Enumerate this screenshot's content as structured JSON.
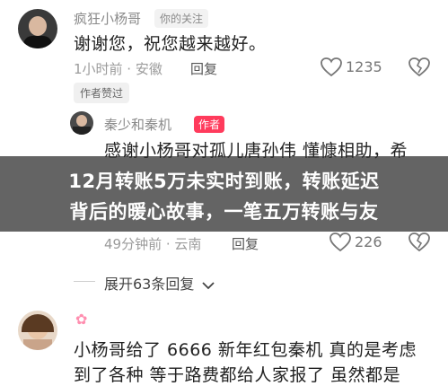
{
  "comment1": {
    "user": "疯狂小杨哥",
    "followed_label": "你的关注",
    "text": "谢谢您，祝您越来越好。",
    "time_location": "1小时前 · 安徽",
    "reply_label": "回复",
    "likes": "1235",
    "author_liked": "作者赞过"
  },
  "comment2": {
    "user": "秦少和秦机",
    "author_label": "作者",
    "text_line1": "感谢小杨哥对孤儿唐孙伟 懂慷相助，希",
    "time_location": "49分钟前 · 云南",
    "reply_label": "回复",
    "likes": "226"
  },
  "overlay": {
    "line1": "12月转账5万未实时到账，转账延迟",
    "line2": "背后的暖心故事，一笔五万转账与友"
  },
  "expand_replies": "展开63条回复",
  "comment3": {
    "text_line1": "小杨哥给了 6666 新年红包秦机 真的是考虑",
    "text_line2": "到了各种 等于路费都给人家报了 虽然都是"
  },
  "colors": {
    "author_badge": "#ff3b5c",
    "overlay_bg": "#282828"
  }
}
